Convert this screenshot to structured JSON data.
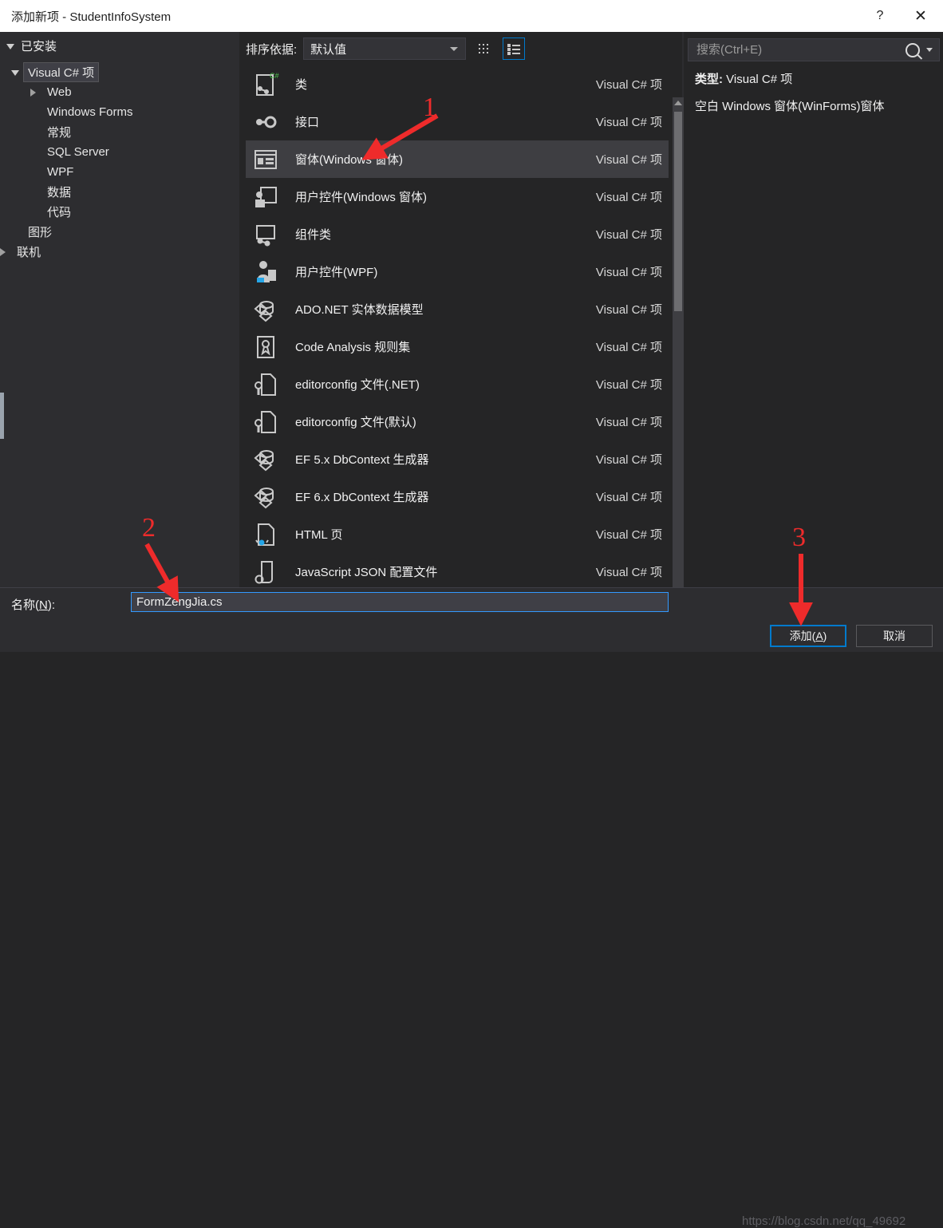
{
  "window": {
    "title": "添加新项 - StudentInfoSystem",
    "help_label": "?",
    "close_label": "✕"
  },
  "sidebar": {
    "header": "已安装",
    "items": [
      {
        "label": "Visual C# 项",
        "indent": 0,
        "expander": "open",
        "selected": true
      },
      {
        "label": "Web",
        "indent": 1,
        "expander": "closed",
        "selected": false
      },
      {
        "label": "Windows Forms",
        "indent": 1,
        "expander": "none",
        "selected": false
      },
      {
        "label": "常规",
        "indent": 1,
        "expander": "none",
        "selected": false
      },
      {
        "label": "SQL Server",
        "indent": 1,
        "expander": "none",
        "selected": false
      },
      {
        "label": "WPF",
        "indent": 1,
        "expander": "none",
        "selected": false
      },
      {
        "label": "数据",
        "indent": 1,
        "expander": "none",
        "selected": false
      },
      {
        "label": "代码",
        "indent": 1,
        "expander": "none",
        "selected": false
      },
      {
        "label": "图形",
        "indent": 0,
        "expander": "none",
        "selected": false
      },
      {
        "label": "联机",
        "indent": -1,
        "expander": "closed",
        "selected": false
      }
    ]
  },
  "toolbar": {
    "sort_label": "排序依据:",
    "sort_value": "默认值",
    "grid_view_icon": "grid-view-icon",
    "list_view_icon": "list-view-icon",
    "list_view_active": true
  },
  "list": {
    "type_label": "Visual C# 项",
    "items": [
      {
        "name": "类",
        "type": "Visual C# 项",
        "icon": "class-icon",
        "selected": false
      },
      {
        "name": "接口",
        "type": "Visual C# 项",
        "icon": "interface-icon",
        "selected": false
      },
      {
        "name": "窗体(Windows 窗体)",
        "type": "Visual C# 项",
        "icon": "windows-form-icon",
        "selected": true
      },
      {
        "name": "用户控件(Windows 窗体)",
        "type": "Visual C# 项",
        "icon": "user-control-winforms-icon",
        "selected": false
      },
      {
        "name": "组件类",
        "type": "Visual C# 项",
        "icon": "component-class-icon",
        "selected": false
      },
      {
        "name": "用户控件(WPF)",
        "type": "Visual C# 项",
        "icon": "user-control-wpf-icon",
        "selected": false
      },
      {
        "name": "ADO.NET 实体数据模型",
        "type": "Visual C# 项",
        "icon": "ado-net-entity-model-icon",
        "selected": false
      },
      {
        "name": "Code Analysis 规则集",
        "type": "Visual C# 项",
        "icon": "code-analysis-ruleset-icon",
        "selected": false
      },
      {
        "name": "editorconfig 文件(.NET)",
        "type": "Visual C# 项",
        "icon": "editorconfig-icon",
        "selected": false
      },
      {
        "name": "editorconfig 文件(默认)",
        "type": "Visual C# 项",
        "icon": "editorconfig-icon",
        "selected": false
      },
      {
        "name": "EF 5.x DbContext 生成器",
        "type": "Visual C# 项",
        "icon": "ef-dbcontext-icon",
        "selected": false
      },
      {
        "name": "EF 6.x DbContext 生成器",
        "type": "Visual C# 项",
        "icon": "ef-dbcontext-icon",
        "selected": false
      },
      {
        "name": "HTML 页",
        "type": "Visual C# 项",
        "icon": "html-page-icon",
        "selected": false
      },
      {
        "name": "JavaScript JSON 配置文件",
        "type": "Visual C# 项",
        "icon": "js-json-config-icon",
        "selected": false
      }
    ]
  },
  "search": {
    "placeholder": "搜索(Ctrl+E)",
    "value": "",
    "icon": "search-icon"
  },
  "details": {
    "type_prefix": "类型:",
    "type_value": "Visual C# 项",
    "description": "空白 Windows 窗体(WinForms)窗体"
  },
  "footer": {
    "name_label_pre": "名称(",
    "name_label_key": "N",
    "name_label_post": "):",
    "name_value": "FormZengJia.cs",
    "add_pre": "添加(",
    "add_key": "A",
    "add_post": ")",
    "cancel_label": "取消"
  },
  "watermark": {
    "text": "https://blog.csdn.net/qq_49692"
  },
  "annotations": [
    {
      "number": "1",
      "target": "selected-list-item"
    },
    {
      "number": "2",
      "target": "name-input"
    },
    {
      "number": "3",
      "target": "add-button"
    }
  ],
  "colors": {
    "accent": "#007acc",
    "dialog_bg": "#2d2d30",
    "pane_bg": "#252526",
    "selection": "#3e3e42",
    "annotation": "#ee2b2b",
    "titlebar_bg": "#ffffff"
  }
}
